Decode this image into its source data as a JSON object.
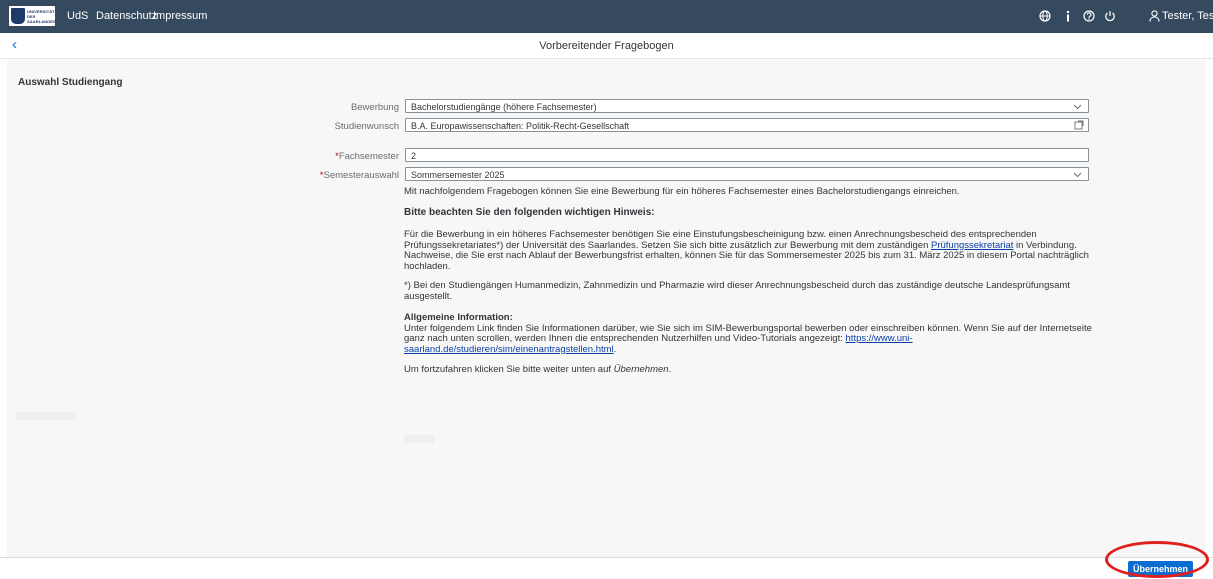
{
  "shell": {
    "logo_text": "UNIVERSITÄT DES SAARLANDES",
    "links": [
      "UdS",
      "Datenschutz",
      "Impressum"
    ],
    "user": "Tester, Test",
    "icons": [
      "globe-icon",
      "info-icon",
      "help-icon",
      "power-icon",
      "user-icon"
    ]
  },
  "header": {
    "back_icon": "‹",
    "title": "Vorbereitender Fragebogen"
  },
  "section": {
    "title": "Auswahl Studiengang"
  },
  "form": {
    "bewerbung_label": "Bewerbung",
    "bewerbung_value": "Bachelorstudiengänge (höhere Fachsemester)",
    "studienwunsch_label": "Studienwunsch",
    "studienwunsch_value": "B.A. Europawissenschaften: Politik-Recht-Gesellschaft",
    "fachsemester_label": "Fachsemester",
    "fachsemester_value": "2",
    "semester_label": "Semesterauswahl",
    "semester_value": "Sommersemester 2025",
    "required_marker": "*"
  },
  "info": {
    "intro": "Mit nachfolgendem Fragebogen können Sie eine Bewerbung für ein höheres Fachsemester eines Bachelorstudiengangs einreichen.",
    "hint_heading": "Bitte beachten Sie den folgenden wichtigen Hinweis:",
    "hint_p1_before": "Für die Bewerbung in ein höheres Fachsemester benötigen Sie eine Einstufungsbescheinigung bzw. einen Anrechnungsbescheid des entsprechenden Prüfungssekretariates*) der Universität des Saarlandes. Setzen Sie sich bitte zusätzlich zur Bewerbung mit dem zuständigen ",
    "hint_p1_link": "Prüfungssekretariat",
    "hint_p1_after": " in Verbindung. Nachweise, die Sie erst nach Ablauf der Bewerbungsfrist erhalten, können Sie für das Sommersemester 2025 bis zum 31. März 2025 in diesem Portal nachträglich hochladen.",
    "footnote": "*) Bei den Studiengängen Humanmedizin, Zahnmedizin und Pharmazie wird dieser Anrechnungsbescheid durch das zuständige deutsche Landesprüfungsamt ausgestellt.",
    "general_heading": "Allgemeine Information:",
    "general_text": "Unter folgendem Link finden Sie Informationen darüber, wie Sie sich im SIM-Bewerbungsportal bewerben oder einschreiben können. Wenn Sie auf der Internetseite ganz nach unten scrollen, werden Ihnen die entsprechenden Nutzerhilfen und Video-Tutorials angezeigt: ",
    "general_link": "https://www.uni-saarland.de/studieren/sim/einenantragstellen.html",
    "general_end": ".",
    "continue_before": "Um fortzufahren klicken Sie bitte weiter unten auf ",
    "continue_em": "Übernehmen",
    "continue_after": "."
  },
  "footer": {
    "accept_label": "Übernehmen"
  },
  "colors": {
    "shell": "#354a5f",
    "accent": "#0a6ed1",
    "highlight": "#e0201f"
  }
}
